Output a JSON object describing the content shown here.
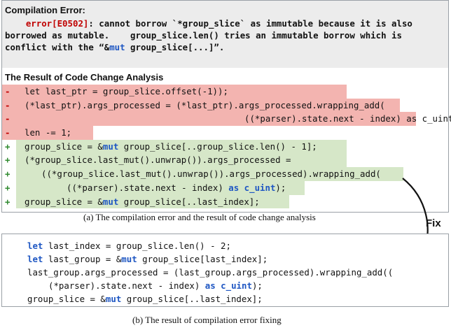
{
  "error_panel": {
    "title": "Compilation Error:",
    "code": "error[E0502]",
    "message_part1": ": cannot borrow `*group_slice` as immutable because it is also borrowed as mutable.    group_slice.len() tries an immutable borrow which is conflict with the “&",
    "kw_mut": "mut",
    "message_part2": " group_slice[...]”."
  },
  "analysis": {
    "title": "The Result of Code Change Analysis",
    "lines": [
      {
        "mark": "-",
        "type": "del",
        "parts": [
          {
            "t": "let last_ptr = group_slice.offset(-1));"
          }
        ]
      },
      {
        "mark": "-",
        "type": "del",
        "parts": [
          {
            "t": "(*last_ptr).args_processed = (*last_ptr).args_processed.wrapping_add("
          }
        ]
      },
      {
        "mark": "-",
        "type": "del",
        "parts": [
          {
            "t": "((*parser).state.next - index) as c_uint)"
          }
        ]
      },
      {
        "mark": "-",
        "type": "del",
        "parts": [
          {
            "t": "len -= 1;"
          }
        ]
      },
      {
        "mark": "+",
        "type": "add",
        "parts": [
          {
            "t": "group_slice = &"
          },
          {
            "t": "mut",
            "kw": true
          },
          {
            "t": " group_slice[..group_slice.len() - 1];"
          }
        ]
      },
      {
        "mark": "+",
        "type": "add",
        "parts": [
          {
            "t": "(*group_slice.last_mut().unwrap()).args_processed ="
          }
        ]
      },
      {
        "mark": "+",
        "type": "add",
        "parts": [
          {
            "t": "((*group_slice.last_mut().unwrap()).args_processed).wrapping_add("
          }
        ]
      },
      {
        "mark": "+",
        "type": "add",
        "parts": [
          {
            "t": "((*parser).state.next - index) "
          },
          {
            "t": "as c_uint",
            "kw": true
          },
          {
            "t": ");"
          }
        ]
      },
      {
        "mark": "+",
        "type": "add",
        "parts": [
          {
            "t": "group_slice = &"
          },
          {
            "t": "mut",
            "kw": true
          },
          {
            "t": " group_slice[..last_index];"
          }
        ]
      }
    ]
  },
  "caption_a": "(a) The compilation error and the result of code change analysis",
  "fix_label": "Fix",
  "fix": {
    "lines": [
      {
        "parts": [
          {
            "t": "let",
            "kw": true
          },
          {
            "t": " last_index = group_slice.len() - 2;"
          }
        ]
      },
      {
        "parts": [
          {
            "t": "let",
            "kw": true
          },
          {
            "t": " last_group = &"
          },
          {
            "t": "mut",
            "kw": true
          },
          {
            "t": " group_slice[last_index];"
          }
        ]
      },
      {
        "parts": [
          {
            "t": "last_group.args_processed = (last_group.args_processed).wrapping_add(("
          }
        ]
      },
      {
        "parts": [
          {
            "t": "(*parser).state.next - index) "
          },
          {
            "t": "as c_uint",
            "kw": true
          },
          {
            "t": ");"
          }
        ]
      },
      {
        "parts": [
          {
            "t": "group_slice = &"
          },
          {
            "t": "mut",
            "kw": true
          },
          {
            "t": " group_slice[..last_index];"
          }
        ]
      }
    ]
  },
  "caption_b": "(b) The result of compilation error fixing",
  "colors": {
    "deleted_bg": "#f3b4b0",
    "added_bg": "#d6e7c8",
    "keyword": "#1f57c3",
    "error_code": "#c00000",
    "arrow": "#111111"
  }
}
